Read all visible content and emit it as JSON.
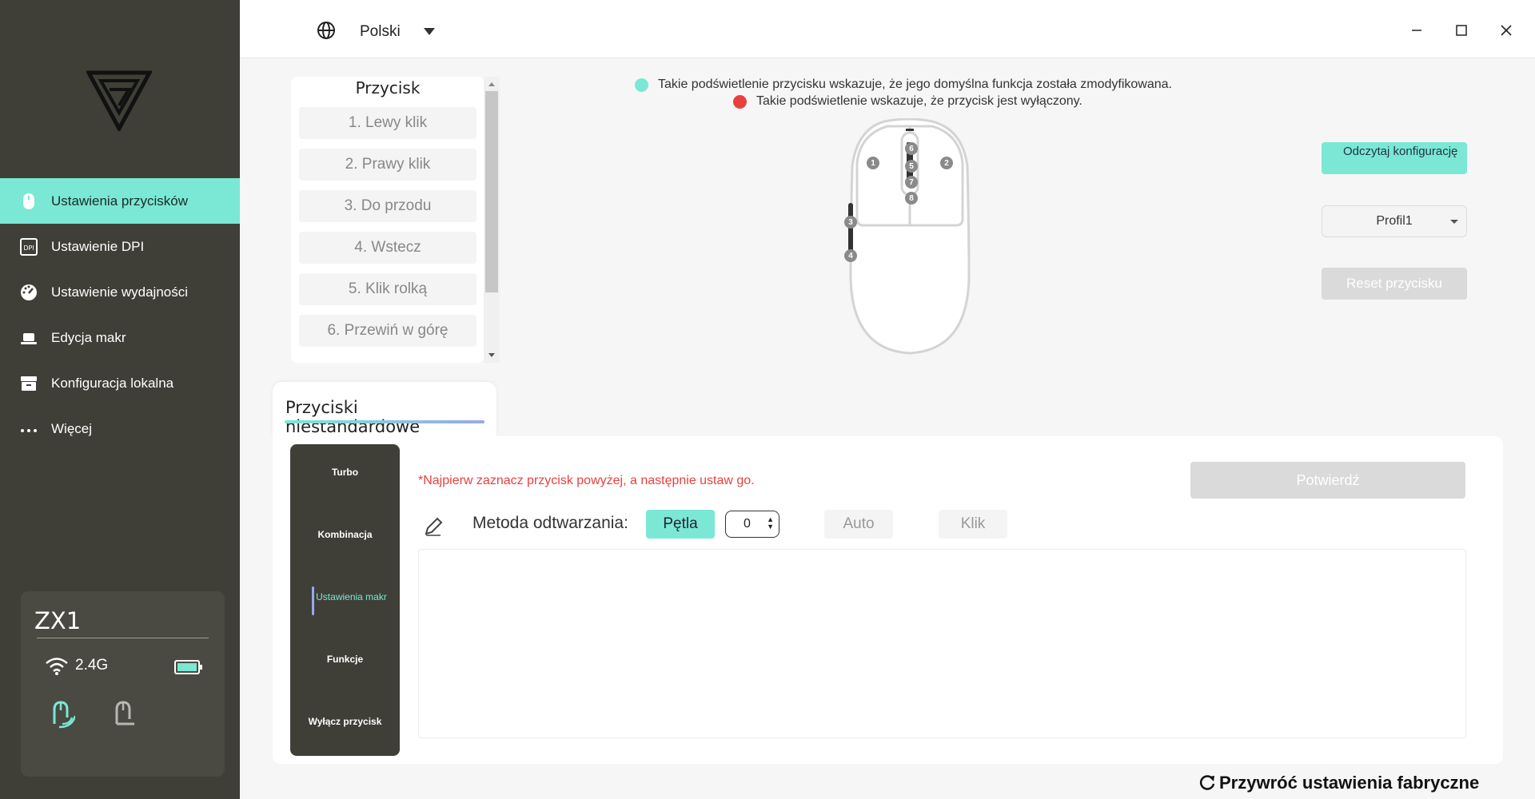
{
  "topbar": {
    "language": "Polski",
    "globe_icon": "globe-icon",
    "window_controls": [
      "minimize-icon",
      "maximize-icon",
      "close-icon"
    ]
  },
  "sidebar": {
    "items": [
      {
        "label": "Ustawienia przycisków",
        "icon": "mouse-icon",
        "active": true
      },
      {
        "label": "Ustawienie DPI",
        "icon": "dpi-icon",
        "active": false
      },
      {
        "label": "Ustawienie wydajności",
        "icon": "gauge-icon",
        "active": false
      },
      {
        "label": "Edycja makr",
        "icon": "keyboard-icon",
        "active": false
      },
      {
        "label": "Konfiguracja lokalna",
        "icon": "archive-icon",
        "active": false
      },
      {
        "label": "Więcej",
        "icon": "more-icon",
        "active": false
      }
    ],
    "device": {
      "name": "ZX1",
      "connection": "2.4G",
      "battery_level": 1.0
    }
  },
  "buttons_panel": {
    "title": "Przycisk",
    "items": [
      "1. Lewy klik",
      "2. Prawy klik",
      "3. Do przodu",
      "4. Wstecz",
      "5. Klik rolką",
      "6. Przewiń w górę"
    ]
  },
  "legend": {
    "modified": "Takie podświetlenie przycisku wskazuje, że jego domyślna funkcja została zmodyfikowana.",
    "disabled": "Takie podświetlenie wskazuje, że przycisk jest wyłączony."
  },
  "mouse_labels": [
    "1",
    "2",
    "3",
    "4",
    "5",
    "6",
    "7",
    "8"
  ],
  "right_panel": {
    "read_config": "Odczytaj konfigurację",
    "profile": "Profil1",
    "reset": "Reset przycisku"
  },
  "custom": {
    "tab_label": "Przyciski niestandardowe",
    "functions": [
      "Turbo",
      "Kombinacja",
      "Ustawienia makr",
      "Funkcje",
      "Wyłącz przycisk"
    ],
    "active_function": "Ustawienia makr",
    "hint": "*Najpierw zaznacz przycisk powyżej, a następnie ustaw go.",
    "confirm": "Potwierdź",
    "play_method_label": "Metoda odtwarzania:",
    "loop": "Pętla",
    "repeat_count": "0",
    "auto": "Auto",
    "click": "Klik"
  },
  "factory_reset": "Przywróć ustawienia fabryczne",
  "colors": {
    "accent": "#7ae8d4",
    "sidebar": "#3f3f37",
    "disabled_dot": "#e8413d",
    "modified_dot": "#7ae8d4"
  }
}
